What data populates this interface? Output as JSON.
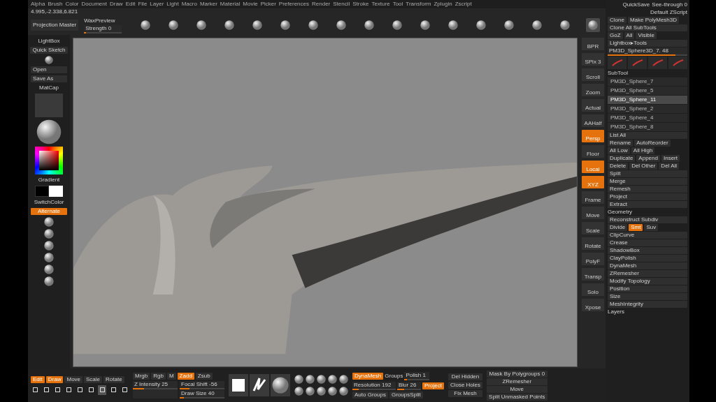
{
  "menu_bar": [
    "Alpha",
    "Brush",
    "Color",
    "Document",
    "Draw",
    "Edit",
    "File",
    "Layer",
    "Light",
    "Macro",
    "Marker",
    "Material",
    "Movie",
    "Picker",
    "Preferences",
    "Render",
    "Stencil",
    "Stroke",
    "Texture",
    "Tool",
    "Transform",
    "Zplugin",
    "Zscript"
  ],
  "coordinates": "4.995,-2.338,6.821",
  "projection": {
    "button": "Projection Master",
    "label": "WaxPreview",
    "strength": "Strength 0",
    "level": 0.05
  },
  "top_brush_count_selected": [
    {
      "selected": false
    },
    {
      "selected": false
    },
    {
      "selected": false
    },
    {
      "selected": false
    },
    {
      "selected": false
    },
    {
      "selected": false
    },
    {
      "selected": false
    },
    {
      "selected": false
    },
    {
      "selected": false
    },
    {
      "selected": false
    },
    {
      "selected": false
    },
    {
      "selected": false
    },
    {
      "selected": false
    },
    {
      "selected": false
    },
    {
      "selected": false
    },
    {
      "selected": false
    },
    {
      "selected": true
    }
  ],
  "top_right": {
    "quicksave": "QuickSave",
    "menus": "Default ZScript",
    "see_through": "See-through 0"
  },
  "left_panel": {
    "lightbox": "LightBox",
    "quick_sketch": "Quick Sketch",
    "open": "Open",
    "save_as": "Save As",
    "material_label": "MatCap",
    "gradient": "Gradient",
    "switch_color": "SwitchColor",
    "alternate": {
      "label": "Alternate",
      "selected": true
    }
  },
  "right_shelf": [
    {
      "label": "BPR",
      "selected": false
    },
    {
      "label": "SPix 3",
      "selected": false
    },
    {
      "label": "Scroll",
      "selected": false
    },
    {
      "label": "Zoom",
      "selected": false
    },
    {
      "label": "Actual",
      "selected": false
    },
    {
      "label": "AAHalf",
      "selected": false
    },
    {
      "label": "Persp",
      "selected": true
    },
    {
      "label": "Floor",
      "selected": false
    },
    {
      "label": "Local",
      "selected": true
    },
    {
      "label": "XYZ",
      "selected": true
    },
    {
      "label": "Frame",
      "selected": false
    },
    {
      "label": "Move",
      "selected": false
    },
    {
      "label": "Scale",
      "selected": false
    },
    {
      "label": "Rotate",
      "selected": false
    },
    {
      "label": "PolyF",
      "selected": false
    },
    {
      "label": "Transp",
      "selected": false
    },
    {
      "label": "Solo",
      "selected": false
    },
    {
      "label": "Xpose",
      "selected": false
    }
  ],
  "tool_panel": {
    "clone": "Clone",
    "make_polymesh": "Make PolyMesh3D",
    "clone_all": "Clone All SubTools",
    "goz": "GoZ",
    "all": "All",
    "visible": "Visible",
    "lightbox_tools": "Lightbox▸Tools",
    "current_tool": {
      "label": "PM3D_Sphere3D_7. 48",
      "level": 0.85
    },
    "subtool_header": "SubTool",
    "subtools": [
      {
        "name": "PM3D_Sphere_7",
        "selected": false
      },
      {
        "name": "PM3D_Sphere_5",
        "selected": false
      },
      {
        "name": "PM3D_Sphere_11",
        "selected": true
      },
      {
        "name": "PM3D_Sphere_2",
        "selected": false
      },
      {
        "name": "PM3D_Sphere_4",
        "selected": false
      },
      {
        "name": "PM3D_Sphere_8",
        "selected": false
      }
    ],
    "list_all": "List All",
    "rename": "Rename",
    "autoreorder": "AutoReorder",
    "all_low": "All Low",
    "all_high": "All High",
    "duplicate": "Duplicate",
    "append": "Append",
    "insert": "Insert",
    "delete": "Delete",
    "del_other": "Del Other",
    "del_all": "Del All",
    "actions": [
      "Split",
      "Merge",
      "Remesh",
      "Project",
      "Extract"
    ],
    "geometry": "Geometry",
    "reconstruct": "Reconstruct Subdiv",
    "divide": "Divide",
    "divide_options": [
      {
        "label": "Smt",
        "selected": true
      },
      {
        "label": "Suv",
        "selected": false
      }
    ],
    "sections": [
      "ClipCurve",
      "Crease",
      "ShadowBox",
      "ClayPolish",
      "DynaMesh",
      "ZRemesher",
      "Modify Topology",
      "Position",
      "Size",
      "MeshIntegrity"
    ],
    "layers": "Layers"
  },
  "bottom_shelf": {
    "modes": [
      {
        "label": "Edit",
        "selected": true
      },
      {
        "label": "Draw",
        "selected": true
      },
      {
        "label": "Move",
        "selected": false
      },
      {
        "label": "Scale",
        "selected": false
      },
      {
        "label": "Rotate",
        "selected": false
      }
    ],
    "mrgb": "Mrgb",
    "rgb": "Rgb",
    "m": "M",
    "zadd": {
      "label": "Zadd",
      "selected": true
    },
    "zsub": {
      "label": "Zsub",
      "selected": false
    },
    "z_intensity": {
      "label": "Z Intensity 25",
      "level": 0.25
    },
    "focal_shift": {
      "label": "Focal Shift -56",
      "level": 0.22
    },
    "draw_size": {
      "label": "Draw Size 40",
      "level": 0.1
    },
    "strokes": [
      {
        "selected": false
      },
      {
        "selected": false
      },
      {
        "selected": false
      },
      {
        "selected": false
      },
      {
        "selected": false
      },
      {
        "selected": false
      },
      {
        "selected": true
      },
      {
        "selected": false
      },
      {
        "selected": false
      }
    ],
    "dynamesh": {
      "label": "DynaMesh",
      "selected": true
    },
    "groups": "Groups",
    "polish": {
      "label": "Polish 1",
      "level": 0.1
    },
    "blur": {
      "label": "Blur 26",
      "level": 0.3
    },
    "project": {
      "label": "Project",
      "selected": true
    },
    "resolution": {
      "label": "Resolution 192",
      "level": 0.15
    },
    "auto_groups": "Auto Groups",
    "groups_split": "GroupsSplit",
    "del_hidden": "Del Hidden",
    "close_holes": "Close Holes",
    "fix_mesh": "Fix Mesh",
    "mask_polygroups": "Mask By Polygroups 0",
    "zremesher": "ZRemesher",
    "mode": "Move",
    "split_unmasked": "Split Unmasked Points"
  }
}
